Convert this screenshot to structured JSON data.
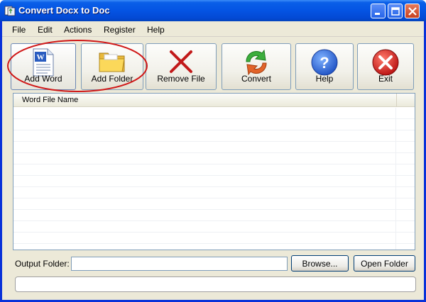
{
  "window": {
    "title": "Convert Docx to Doc"
  },
  "menu": [
    "File",
    "Edit",
    "Actions",
    "Register",
    "Help"
  ],
  "toolbar": [
    {
      "label": "Add Word",
      "icon": "word-document-icon"
    },
    {
      "label": "Add Folder",
      "icon": "folder-icon"
    },
    {
      "label": "Remove File",
      "icon": "red-x-icon"
    },
    {
      "label": "Convert",
      "icon": "convert-arrows-icon"
    },
    {
      "label": "Help",
      "icon": "help-icon"
    },
    {
      "label": "Exit",
      "icon": "exit-icon"
    }
  ],
  "file_list": {
    "column_header": "Word File Name",
    "rows": []
  },
  "output": {
    "label": "Output Folder:",
    "value": ""
  },
  "buttons": {
    "browse": "Browse...",
    "open_folder": "Open Folder"
  },
  "status": {
    "text": ""
  },
  "colors": {
    "titlebar": "#0454e3",
    "window_bg": "#ece9d8",
    "highlight": "#d01818"
  }
}
